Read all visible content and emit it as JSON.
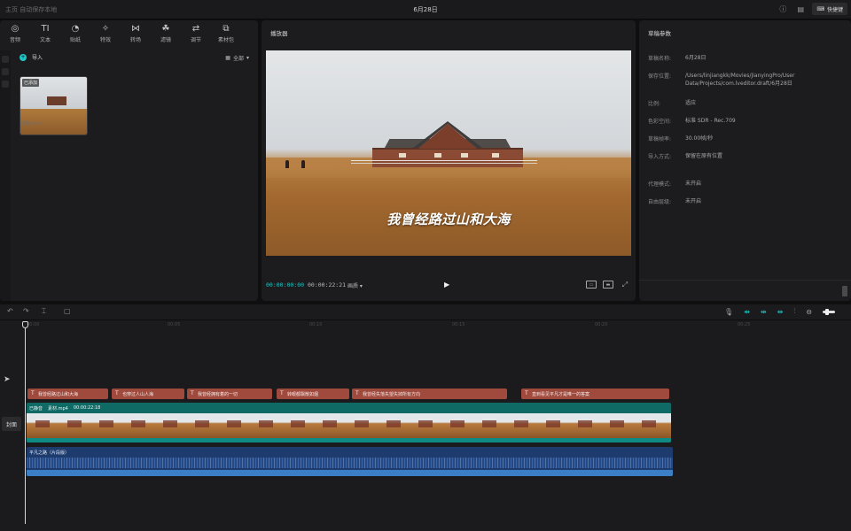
{
  "window": {
    "left_title": "主页  自动保存本地",
    "center_title": "6月28日",
    "shortcut_label": "快捷键"
  },
  "toolbar": {
    "items": [
      {
        "label": "音频",
        "icon": "audio-icon"
      },
      {
        "label": "文本",
        "icon": "text-icon"
      },
      {
        "label": "贴纸",
        "icon": "sticker-icon"
      },
      {
        "label": "特效",
        "icon": "effects-icon"
      },
      {
        "label": "转场",
        "icon": "transition-icon"
      },
      {
        "label": "滤镜",
        "icon": "filter-icon"
      },
      {
        "label": "调节",
        "icon": "adjust-icon"
      },
      {
        "label": "素材包",
        "icon": "package-icon"
      }
    ]
  },
  "media": {
    "import_label": "导入",
    "view_label": "全部",
    "thumb_badge": "已添加",
    "thumb_name": "素材.mp4"
  },
  "player": {
    "title": "播放器",
    "subtitle": "我曾经路过山和大海",
    "current_time": "00:00:00:00",
    "total_time": "00:00:22:21",
    "quality": "画质"
  },
  "draft": {
    "title": "草稿参数",
    "rows": [
      {
        "key": "草稿名称:",
        "value": "6月28日"
      },
      {
        "key": "保存位置:",
        "value": "/Users/linjiangkk/Movies/JianyingPro/User Data/Projects/com.lveditor.draft/6月28日"
      },
      {
        "key": "比例:",
        "value": "适应"
      },
      {
        "key": "色彩空间:",
        "value": "标准 SDR - Rec.709"
      },
      {
        "key": "草稿帧率:",
        "value": "30.00帧/秒"
      },
      {
        "key": "导入方式:",
        "value": "保留在原有位置"
      },
      {
        "key": "代理模式:",
        "value": "未开启"
      },
      {
        "key": "自由层级:",
        "value": "未开启"
      }
    ]
  },
  "timeline": {
    "ruler": [
      "00:00",
      "00:05",
      "00:10",
      "00:15",
      "00:20",
      "00:25"
    ],
    "cover_label": "封面",
    "subtitles": [
      "我曾经路过山和大海",
      "也穿过人山人海",
      "我曾经拥有着的一切",
      "转眼都飘散如烟",
      "我曾经失落失望失掉所有方向",
      "直到看见平凡才是唯一的答案"
    ],
    "video_clip": {
      "name": "素材.mp4",
      "duration": "00:00:22:18",
      "badge": "已静音"
    },
    "audio_clip": {
      "name": "平凡之路（片段版）"
    }
  },
  "colors": {
    "accent": "#1fc6c6",
    "subtitle_clip": "#a04a3e",
    "video_clip": "#0f6a66",
    "audio_clip": "#1e3b6d"
  }
}
